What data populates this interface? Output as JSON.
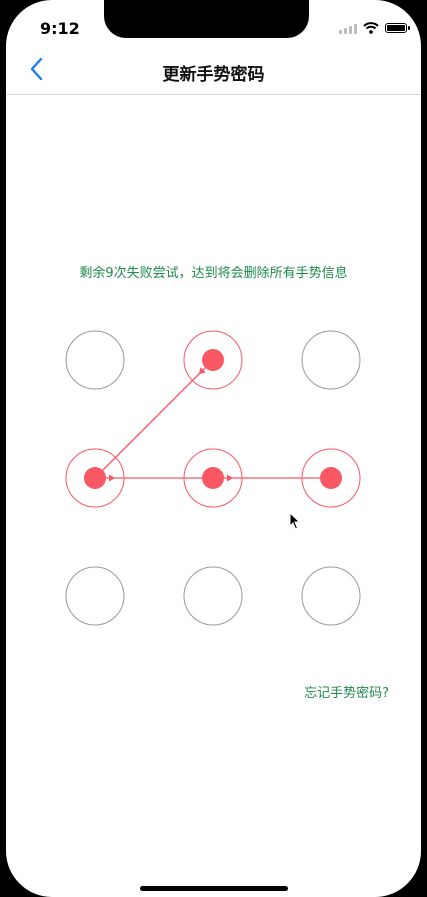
{
  "status": {
    "time": "9:12",
    "wifi_icon": "wifi-icon",
    "battery_icon": "battery-icon"
  },
  "navbar": {
    "back_icon": "chevron-left-icon",
    "title": "更新手势密码"
  },
  "pattern": {
    "hint": "剩余9次失败尝试，达到将会删除所有手势信息",
    "forgot_link": "忘记手势密码?",
    "grid_size": 3,
    "selected_nodes": [
      1,
      3,
      4,
      5
    ],
    "path_order": [
      3,
      1,
      3,
      4,
      5
    ],
    "colors": {
      "active": "#f85763",
      "inactive_border": "#999999",
      "hint_text": "#1f8a4c",
      "link": "#1f8a4c"
    }
  }
}
